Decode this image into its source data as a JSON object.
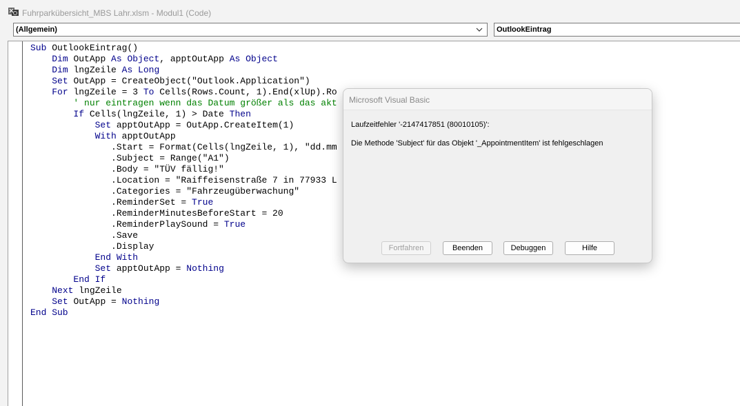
{
  "window": {
    "title": "Fuhrparkübersicht_MBS Lahr.xlsm - Modul1 (Code)",
    "icon": "vba-editor-icon"
  },
  "object_selector": {
    "value": "(Allgemein)"
  },
  "procedure_selector": {
    "value": "OutlookEintrag"
  },
  "code": {
    "lines": [
      [
        {
          "t": "Sub ",
          "c": "kw"
        },
        {
          "t": "OutlookEintrag()"
        }
      ],
      [
        {
          "t": "    "
        },
        {
          "t": "Dim ",
          "c": "kw"
        },
        {
          "t": "OutApp "
        },
        {
          "t": "As Object",
          "c": "kw"
        },
        {
          "t": ", apptOutApp "
        },
        {
          "t": "As Object",
          "c": "kw"
        }
      ],
      [
        {
          "t": "    "
        },
        {
          "t": "Dim ",
          "c": "kw"
        },
        {
          "t": "lngZeile "
        },
        {
          "t": "As Long",
          "c": "kw"
        }
      ],
      [
        {
          "t": "    "
        },
        {
          "t": "Set ",
          "c": "kw"
        },
        {
          "t": "OutApp = CreateObject(\"Outlook.Application\")"
        }
      ],
      [
        {
          "t": "    "
        },
        {
          "t": "For ",
          "c": "kw"
        },
        {
          "t": "lngZeile = 3 "
        },
        {
          "t": "To ",
          "c": "kw"
        },
        {
          "t": "Cells(Rows.Count, 1).End(xlUp).Ro"
        }
      ],
      [
        {
          "t": "        "
        },
        {
          "t": "' nur eintragen wenn das Datum größer als das akt",
          "c": "cm"
        }
      ],
      [
        {
          "t": "        "
        },
        {
          "t": "If ",
          "c": "kw"
        },
        {
          "t": "Cells(lngZeile, 1) > Date "
        },
        {
          "t": "Then",
          "c": "kw"
        }
      ],
      [
        {
          "t": "            "
        },
        {
          "t": "Set ",
          "c": "kw"
        },
        {
          "t": "apptOutApp = OutApp.CreateItem(1)"
        }
      ],
      [
        {
          "t": "            "
        },
        {
          "t": "With ",
          "c": "kw"
        },
        {
          "t": "apptOutApp"
        }
      ],
      [
        {
          "t": "               .Start = Format(Cells(lngZeile, 1), \"dd.mm"
        }
      ],
      [
        {
          "t": "               .Subject = Range(\"A1\")"
        }
      ],
      [
        {
          "t": "               .Body = \"TÜV fällig!\""
        }
      ],
      [
        {
          "t": "               .Location = \"Raiffeisenstraße 7 in 77933 L"
        }
      ],
      [
        {
          "t": "               .Categories = \"Fahrzeugüberwachung\""
        }
      ],
      [
        {
          "t": "               .ReminderSet = "
        },
        {
          "t": "True",
          "c": "kw"
        }
      ],
      [
        {
          "t": "               .ReminderMinutesBeforeStart = 20"
        }
      ],
      [
        {
          "t": "               .ReminderPlaySound = "
        },
        {
          "t": "True",
          "c": "kw"
        }
      ],
      [
        {
          "t": "               .Save"
        }
      ],
      [
        {
          "t": "               .Display"
        }
      ],
      [
        {
          "t": "            "
        },
        {
          "t": "End With",
          "c": "kw"
        }
      ],
      [
        {
          "t": "            "
        },
        {
          "t": "Set ",
          "c": "kw"
        },
        {
          "t": "apptOutApp = "
        },
        {
          "t": "Nothing",
          "c": "kw"
        }
      ],
      [
        {
          "t": "        "
        },
        {
          "t": "End If",
          "c": "kw"
        }
      ],
      [
        {
          "t": "    "
        },
        {
          "t": "Next ",
          "c": "kw"
        },
        {
          "t": "lngZeile"
        }
      ],
      [
        {
          "t": "    "
        },
        {
          "t": "Set ",
          "c": "kw"
        },
        {
          "t": "OutApp = "
        },
        {
          "t": "Nothing",
          "c": "kw"
        }
      ],
      [
        {
          "t": "End Sub",
          "c": "kw"
        }
      ]
    ]
  },
  "dialog": {
    "title": "Microsoft Visual Basic",
    "error_line": "Laufzeitfehler '-2147417851 (80010105)':",
    "message": "Die Methode 'Subject' für das Objekt '_AppointmentItem' ist fehlgeschlagen",
    "buttons": {
      "continue": "Fortfahren",
      "end": "Beenden",
      "debug": "Debuggen",
      "help": "Hilfe"
    }
  },
  "colors": {
    "keyword": "#00008b",
    "comment": "#008000"
  }
}
